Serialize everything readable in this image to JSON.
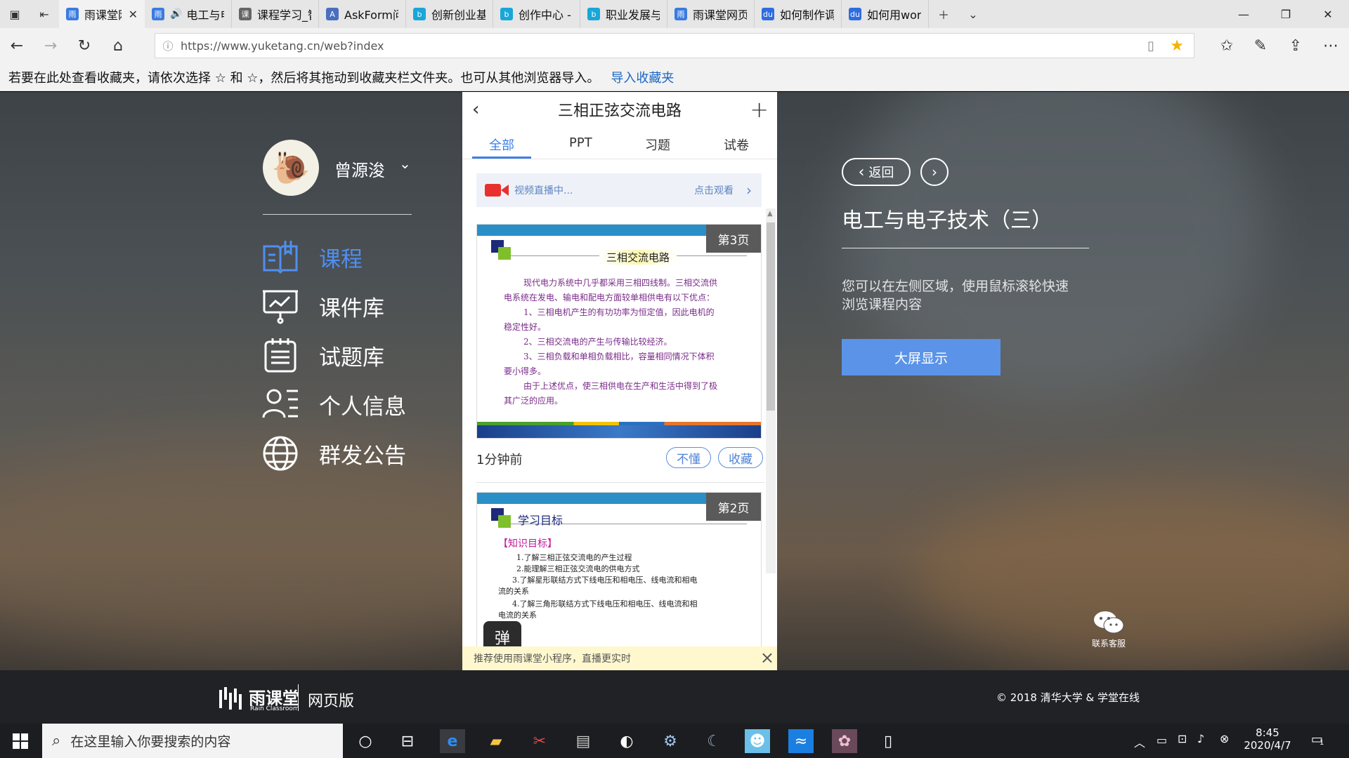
{
  "browser": {
    "tabs": [
      {
        "label": "雨课堂网页",
        "active": true,
        "icon": "yuketang-icon"
      },
      {
        "label": "电工与电",
        "icon": "yuketang-icon"
      },
      {
        "label": "课程学习_智慧",
        "icon": "edu-icon"
      },
      {
        "label": "AskForm问智",
        "icon": "askform-icon"
      },
      {
        "label": "创新创业基础",
        "icon": "bilibili-icon"
      },
      {
        "label": "创作中心 - 哔",
        "icon": "bilibili-icon"
      },
      {
        "label": "职业发展与就",
        "icon": "bilibili-icon"
      },
      {
        "label": "雨课堂网页版",
        "icon": "yuketang-icon"
      },
      {
        "label": "如何制作调查",
        "icon": "baidu-icon"
      },
      {
        "label": "如何用word制",
        "icon": "baidu-icon"
      }
    ],
    "url": "https://www.yuketang.cn/web?index",
    "favbar_text": "若要在此处查看收藏夹，请依次选择 ☆ 和 ☆，然后将其拖动到收藏夹栏文件夹。也可从其他浏览器导入。",
    "favbar_link": "导入收藏夹"
  },
  "sidebar": {
    "username": "曾源浚",
    "items": [
      {
        "label": "课程",
        "icon": "course-book-icon",
        "active": true
      },
      {
        "label": "课件库",
        "icon": "courseware-board-icon"
      },
      {
        "label": "试题库",
        "icon": "question-list-icon"
      },
      {
        "label": "个人信息",
        "icon": "profile-card-icon"
      },
      {
        "label": "群发公告",
        "icon": "globe-icon"
      }
    ]
  },
  "panel": {
    "title": "三相正弦交流电路",
    "tabs": [
      "全部",
      "PPT",
      "习题",
      "试卷"
    ],
    "live_text": "视频直播中...",
    "live_link": "点击观看",
    "card1": {
      "badge": "第3页",
      "slide_title": "三相交流电路",
      "lines": [
        "现代电力系统中几乎都采用三相四线制。三相交流供",
        "电系统在发电、输电和配电方面较单相供电有以下优点：",
        "1、三相电机产生的有功功率为恒定值，因此电机的",
        "稳定性好。",
        "2、三相交流电的产生与传输比较经济。",
        "3、三相负载和单相负载相比，容量相同情况下体积",
        "要小得多。",
        "由于上述优点，使三相供电在生产和生活中得到了极",
        "其广泛的应用。"
      ],
      "time": "1分钟前",
      "btn_dont_understand": "不懂",
      "btn_collect": "收藏"
    },
    "card2": {
      "badge": "第2页",
      "slide_title": "学习目标",
      "section": "【知识目标】",
      "lines": [
        "1.了解三相正弦交流电的产生过程",
        "2.能理解三相正弦交流电的供电方式",
        "3.了解星形联结方式下线电压和相电压、线电流和相电",
        "流的关系",
        "4.了解三角形联结方式下线电压和相电压、线电流和相",
        "电流的关系"
      ]
    },
    "danmu": "弹",
    "tip": "推荐使用雨课堂小程序，直播更实时"
  },
  "right": {
    "back": "返回",
    "course_title": "电工与电子技术（三）",
    "desc": "您可以在左侧区域，使用鼠标滚轮快速浏览课程内容",
    "big_screen": "大屏显示",
    "service": "联系客服"
  },
  "footer": {
    "logo_cn": "雨课堂",
    "logo_en": "Rain Classroom",
    "edition": "网页版",
    "copyright": "© 2018 清华大学 & 学堂在线"
  },
  "taskbar": {
    "search_placeholder": "在这里输入你要搜索的内容",
    "time": "8:45",
    "date": "2020/4/7",
    "notification_count": "1"
  }
}
